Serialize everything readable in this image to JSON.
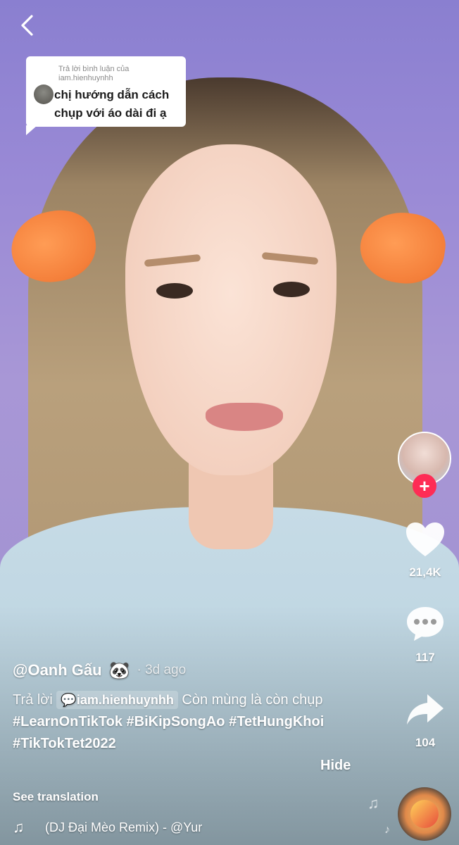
{
  "reply_bubble": {
    "caption": "Trả lời bình luận của iam.hienhuynhh",
    "comment_line1": "chị hướng dẫn cách",
    "comment_line2": "chụp với áo dài đi ạ"
  },
  "rail": {
    "likes": "21,4K",
    "comments": "117",
    "shares": "104"
  },
  "post": {
    "author": "@Oanh Gấu",
    "author_emoji": "🐼",
    "time_ago": "3d ago",
    "reply_word": "Trả lời",
    "mention": "iam.hienhuynhh",
    "text_part1": "Còn mùng là còn chụp",
    "tags": [
      "#LearnOnTikTok",
      "#BiKipSongAo",
      "#TetHungKhoi",
      "#TikTokTet2022"
    ],
    "hide_label": "Hide",
    "see_translation": "See translation"
  },
  "music": {
    "title": "(DJ Đại Mèo Remix) - @Yur"
  },
  "icons": {
    "back": "chevron-left-icon",
    "like": "heart-icon",
    "comment": "chat-bubble-icon",
    "share": "share-arrow-icon",
    "music": "music-note-icon"
  },
  "colors": {
    "follow": "#fe2c55",
    "text": "#ffffff"
  }
}
